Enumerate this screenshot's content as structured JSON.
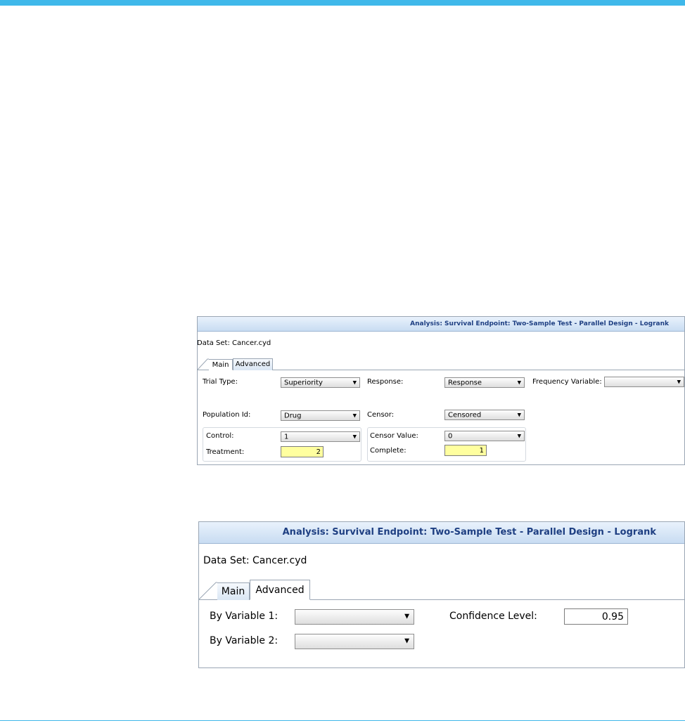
{
  "panel_main": {
    "title": "Analysis: Survival Endpoint: Two-Sample Test - Parallel Design - Logrank",
    "dataset": "Data Set: Cancer.cyd",
    "tabs": {
      "main": "Main",
      "advanced": "Advanced"
    },
    "trial_type": {
      "label": "Trial Type:",
      "value": "Superiority"
    },
    "response": {
      "label": "Response:",
      "value": "Response"
    },
    "frequency_variable": {
      "label": "Frequency Variable:",
      "value": ""
    },
    "population_id": {
      "label": "Population Id:",
      "value": "Drug"
    },
    "censor": {
      "label": "Censor:",
      "value": "Censored"
    },
    "control": {
      "label": "Control:",
      "value": "1"
    },
    "treatment": {
      "label": "Treatment:",
      "value": "2"
    },
    "censor_value": {
      "label": "Censor Value:",
      "value": "0"
    },
    "complete": {
      "label": "Complete:",
      "value": "1"
    },
    "colors": {
      "title_text": "#1e3f82",
      "highlight_input": "#ffff9f"
    }
  },
  "panel_advanced": {
    "title": "Analysis: Survival Endpoint: Two-Sample Test - Parallel Design - Logrank",
    "dataset": "Data Set: Cancer.cyd",
    "tabs": {
      "main": "Main",
      "advanced": "Advanced"
    },
    "by_variable_1": {
      "label": "By Variable 1:",
      "value": ""
    },
    "by_variable_2": {
      "label": "By Variable 2:",
      "value": ""
    },
    "confidence_level": {
      "label": "Confidence Level:",
      "value": "0.95"
    }
  },
  "icons": {
    "dropdown_arrow": "▼"
  },
  "colors": {
    "accent": "#3fb8ea"
  }
}
